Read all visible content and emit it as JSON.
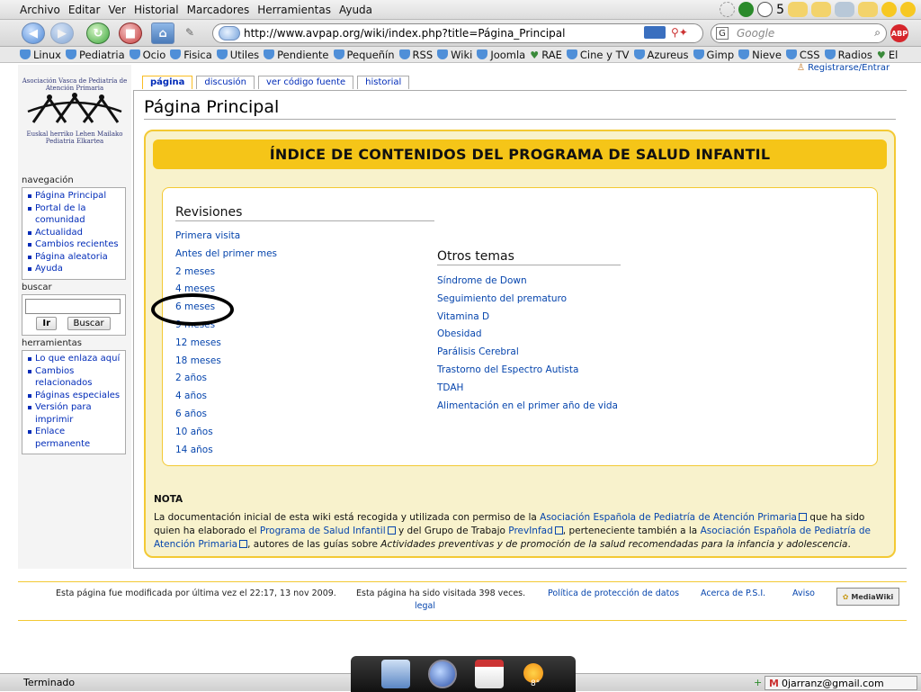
{
  "menubar": {
    "items": [
      "Archivo",
      "Editar",
      "Ver",
      "Historial",
      "Marcadores",
      "Herramientas",
      "Ayuda"
    ],
    "tray_count": "5"
  },
  "navbar": {
    "url": "http://www.avpap.org/wiki/index.php?title=Página_Principal",
    "search_placeholder": "Google",
    "adblock_label": "ABP"
  },
  "bookmarks": [
    "Linux",
    "Pediatria",
    "Ocio",
    "Fisica",
    "Utiles",
    "Pendiente",
    "Pequeñín",
    "RSS",
    "Wiki",
    "Joomla",
    "RAE",
    "Cine y TV",
    "Azureus",
    "Gimp",
    "Nieve",
    "CSS",
    "Radios",
    "El"
  ],
  "login": "Registrarse/Entrar",
  "tabs": [
    "página",
    "discusión",
    "ver código fuente",
    "historial"
  ],
  "logo": {
    "line1": "Asociación Vasca de Pediatría de Atención Primaria",
    "line2": "Euskal herriko Lehen Mailako Pediatria Elkartea"
  },
  "sidebar": {
    "nav_title": "navegación",
    "nav_items": [
      "Página Principal",
      "Portal de la comunidad",
      "Actualidad",
      "Cambios recientes",
      "Página aleatoria",
      "Ayuda"
    ],
    "search_title": "buscar",
    "search_go": "Ir",
    "search_button": "Buscar",
    "tools_title": "herramientas",
    "tools_items": [
      "Lo que enlaza aquí",
      "Cambios relacionados",
      "Páginas especiales",
      "Versión para imprimir",
      "Enlace permanente"
    ]
  },
  "main": {
    "title": "Página Principal",
    "banner": "ÍNDICE DE CONTENIDOS DEL PROGRAMA DE SALUD INFANTIL",
    "revisiones_title": "Revisiones",
    "revisiones": [
      "Primera visita",
      "Antes del primer mes",
      "2 meses",
      "4 meses",
      "6 meses",
      "9 meses",
      "12 meses",
      "18 meses",
      "2 años",
      "4 años",
      "6 años",
      "10 años",
      "14 años"
    ],
    "otros_title": "Otros temas",
    "otros": [
      "Síndrome de Down",
      "Seguimiento del prematuro",
      "Vitamina D",
      "Obesidad",
      "Parálisis Cerebral",
      "Trastorno del Espectro Autista",
      "TDAH",
      "Alimentación en el primer año de vida"
    ],
    "nota_title": "NOTA",
    "nota_1": "La documentación inicial de esta wiki está recogida y utilizada con permiso de la ",
    "nota_link1": "Asociación Española de Pediatría de Atención Primaria",
    "nota_2": " que ha sido quien ha elaborado el ",
    "nota_link2": "Programa de Salud Infantil",
    "nota_3": " y del Grupo de Trabajo ",
    "nota_link3": "PrevInfad",
    "nota_4": ", perteneciente también a la ",
    "nota_link4": "Asociación Española de Pediatría de Atención Primaria",
    "nota_5": ", autores de las guías sobre ",
    "nota_italic": "Actividades preventivas y de promoción de la salud recomendadas para la infancia y adolescencia",
    "nota_6": "."
  },
  "footer": {
    "modified": "Esta página fue modificada por última vez el 22:17, 13 nov 2009.",
    "visits": "Esta página ha sido visitada 398 veces.",
    "privacy": "Política de protección de datos",
    "about": "Acerca de P.S.I.",
    "disclaimer": "Aviso",
    "legal": "legal",
    "badge": "MediaWiki"
  },
  "status": {
    "text": "Terminado",
    "email": "0jarranz@gmail.com",
    "temperature": "8°"
  },
  "colors": {
    "link": "#0645ad",
    "banner": "#f5c518",
    "box_bg": "#f8f2cc",
    "box_border": "#f3c934"
  }
}
